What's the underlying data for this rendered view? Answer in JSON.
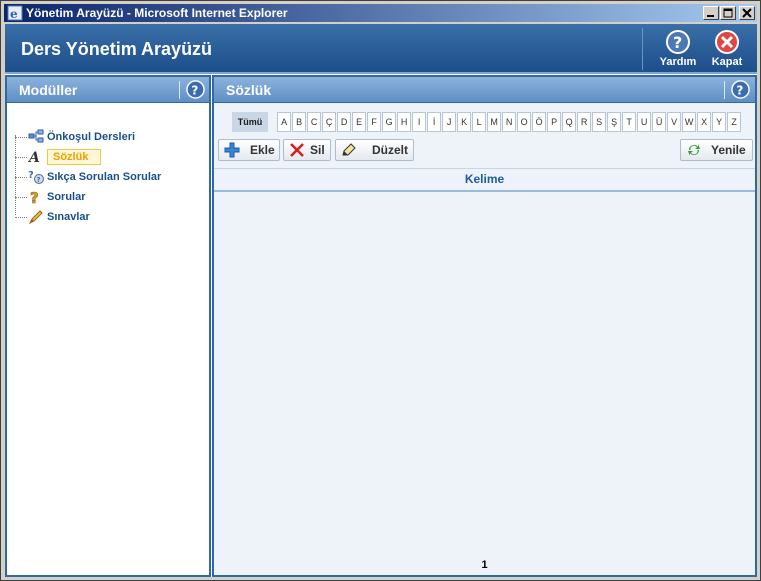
{
  "window": {
    "title": "Yönetim Arayüzü - Microsoft Internet Explorer"
  },
  "header": {
    "app_title": "Ders Yönetim Arayüzü",
    "help_label": "Yardım",
    "close_label": "Kapat"
  },
  "left_panel": {
    "title": "Modüller",
    "items": [
      {
        "label": "Önkoşul Dersleri",
        "icon": "prerequisite-tree-icon"
      },
      {
        "label": "Sözlük",
        "icon": "dictionary-letter-icon",
        "selected": true
      },
      {
        "label": "Sıkça Sorulan Sorular",
        "icon": "faq-icon"
      },
      {
        "label": "Sorular",
        "icon": "question-key-icon"
      },
      {
        "label": "Sınavlar",
        "icon": "pen-exam-icon"
      }
    ]
  },
  "right_panel": {
    "title": "Sözlük",
    "alphabet_all": "Tümü",
    "alphabet": [
      "A",
      "B",
      "C",
      "Ç",
      "D",
      "E",
      "F",
      "G",
      "H",
      "I",
      "İ",
      "J",
      "K",
      "L",
      "M",
      "N",
      "O",
      "Ö",
      "P",
      "Q",
      "R",
      "S",
      "Ş",
      "T",
      "U",
      "Ü",
      "V",
      "W",
      "X",
      "Y",
      "Z"
    ],
    "toolbar": {
      "add": "Ekle",
      "delete": "Sil",
      "edit": "Düzelt",
      "refresh": "Yenile"
    },
    "grid": {
      "column_header": "Kelime"
    },
    "pagination": {
      "page": "1"
    }
  },
  "colors": {
    "header_blue": "#1d4f8a",
    "panel_border": "#2f6aa3",
    "selected_text": "#f0a000"
  }
}
